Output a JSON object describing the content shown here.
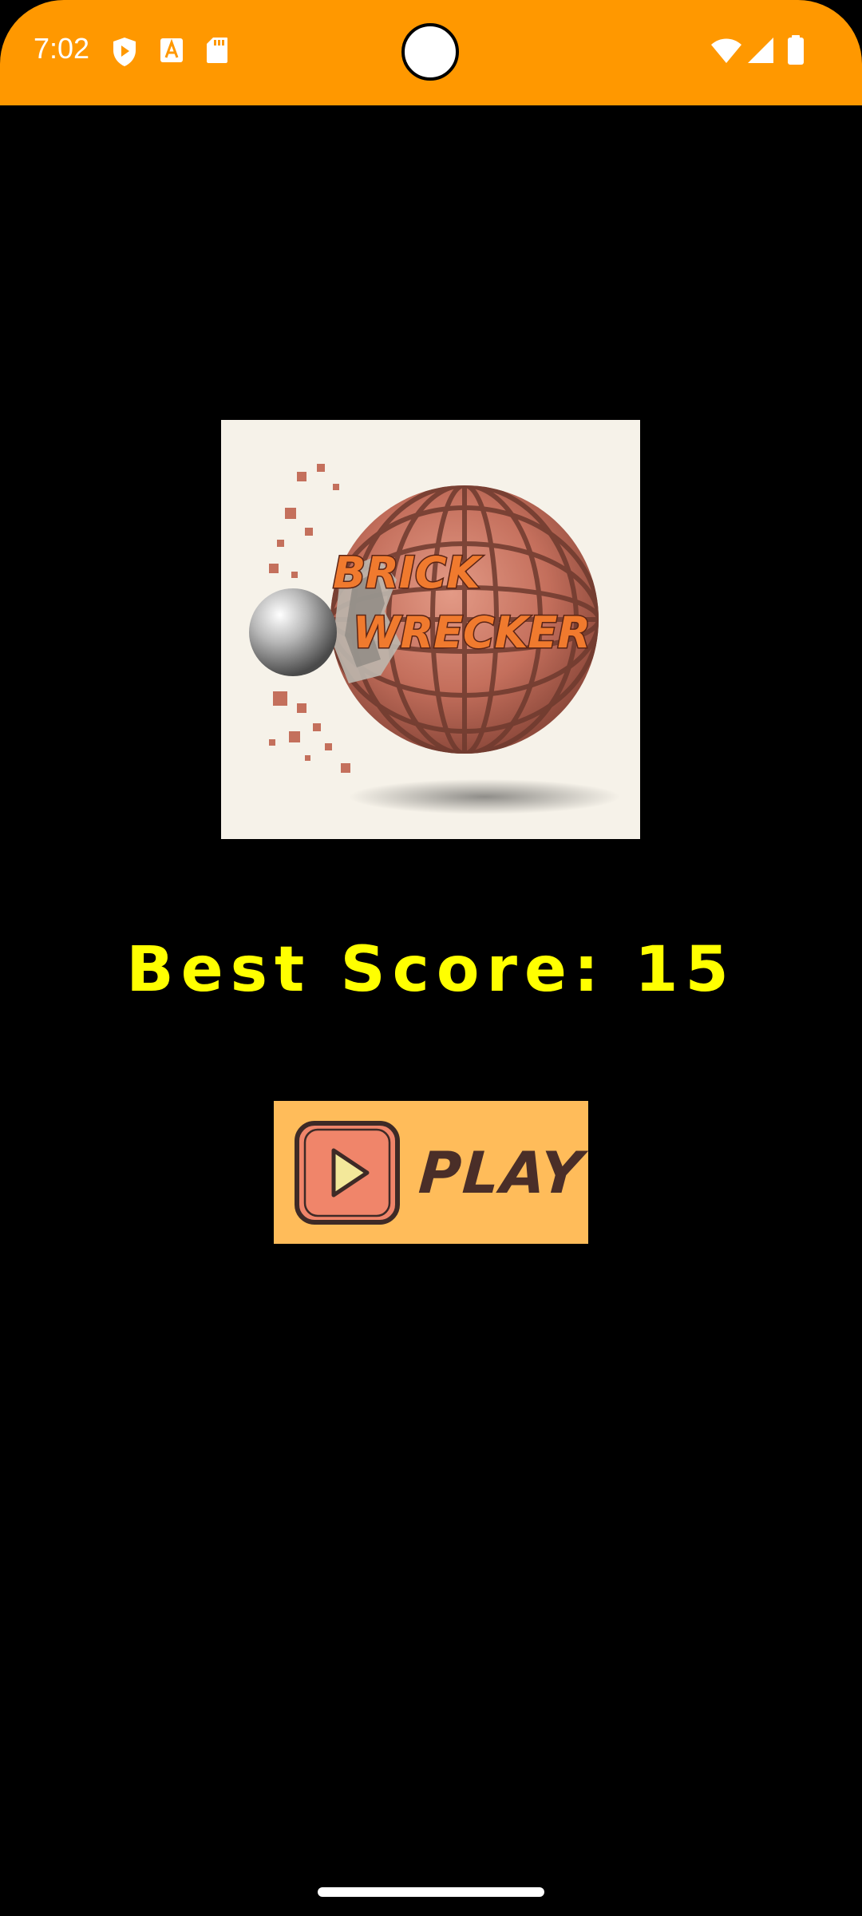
{
  "status_bar": {
    "time": "7:02",
    "background": "#FF9800",
    "left_icons": [
      "shield-play-icon",
      "text-a-icon",
      "sd-card-icon"
    ],
    "right_icons": [
      "wifi-icon",
      "cellular-signal-icon",
      "battery-icon"
    ]
  },
  "logo": {
    "line1": "BRICK",
    "line2": "WRECKER"
  },
  "score": {
    "text": "Best Score: 15",
    "color": "#FFFF00"
  },
  "play_button": {
    "label": "PLAY",
    "background": "#FFBC5A"
  }
}
